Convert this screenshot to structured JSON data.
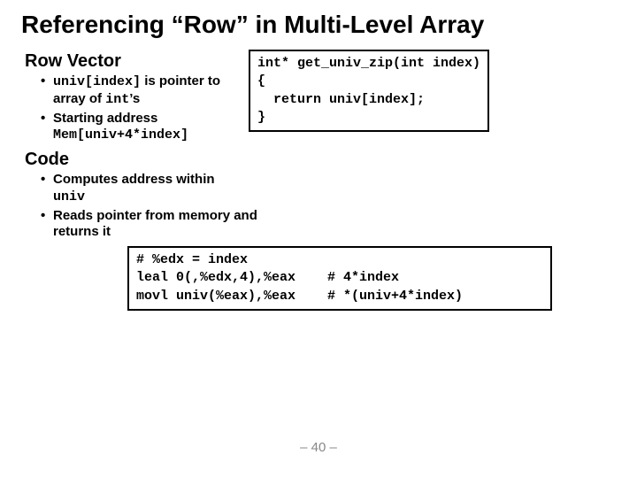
{
  "title": "Referencing “Row” in Multi-Level Array",
  "rowvec": {
    "heading": "Row Vector",
    "b1_pre": "univ[index]",
    "b1_mid": " is pointer to array of ",
    "b1_post": "int",
    "b1_tail": "’s",
    "b2": "Starting address ",
    "b2_code": "Mem[univ+4*index]"
  },
  "c_code": "int* get_univ_zip(int index)\n{\n  return univ[index];\n}",
  "code_sec": {
    "heading": "Code",
    "c1": "Computes address within ",
    "c1_code": "univ",
    "c2": "Reads pointer from memory and returns it"
  },
  "asm": "# %edx = index\nleal 0(,%edx,4),%eax    # 4*index\nmovl univ(%eax),%eax    # *(univ+4*index)",
  "footer": "– 40 –"
}
